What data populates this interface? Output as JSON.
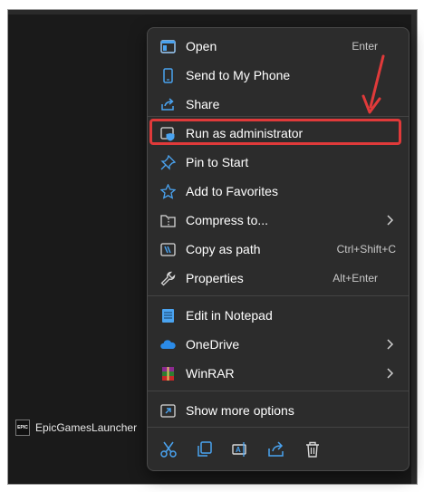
{
  "menu": {
    "items": [
      {
        "label": "Open",
        "shortcut": "Enter",
        "icon": "open-icon"
      },
      {
        "label": "Send to My Phone",
        "shortcut": "",
        "icon": "phone-icon"
      },
      {
        "label": "Share",
        "shortcut": "",
        "icon": "share-icon"
      },
      {
        "label": "Run as administrator",
        "shortcut": "",
        "icon": "shield-icon"
      },
      {
        "label": "Pin to Start",
        "shortcut": "",
        "icon": "pin-icon"
      },
      {
        "label": "Add to Favorites",
        "shortcut": "",
        "icon": "star-icon"
      },
      {
        "label": "Compress to...",
        "shortcut": "",
        "icon": "zip-folder-icon",
        "submenu": true
      },
      {
        "label": "Copy as path",
        "shortcut": "Ctrl+Shift+C",
        "icon": "copy-path-icon"
      },
      {
        "label": "Properties",
        "shortcut": "Alt+Enter",
        "icon": "wrench-icon"
      },
      {
        "label": "Edit in Notepad",
        "shortcut": "",
        "icon": "notepad-icon"
      },
      {
        "label": "OneDrive",
        "shortcut": "",
        "icon": "onedrive-icon",
        "submenu": true
      },
      {
        "label": "WinRAR",
        "shortcut": "",
        "icon": "winrar-icon",
        "submenu": true
      },
      {
        "label": "Show more options",
        "shortcut": "",
        "icon": "more-options-icon"
      }
    ],
    "bottom_actions": [
      "cut-icon",
      "copy-icon",
      "rename-icon",
      "share-icon",
      "delete-icon"
    ]
  },
  "taskbar": {
    "app_label": "EpicGamesLauncher",
    "logo_text": "EPIC"
  },
  "colors": {
    "highlight_border": "#e03a3a",
    "accent_blue": "#4aa3f0",
    "menu_bg": "#2c2c2c"
  }
}
